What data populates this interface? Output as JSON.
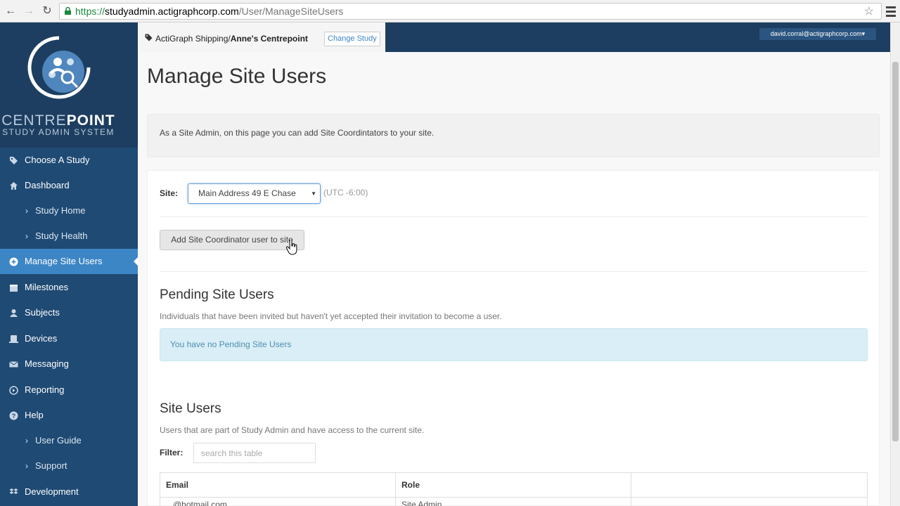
{
  "browser": {
    "url_scheme": "https://",
    "url_host": "studyadmin.actigraphcorp.com",
    "url_path": "/User/ManageSiteUsers"
  },
  "sidebar": {
    "brand_light": "CENTRE",
    "brand_bold": "POINT",
    "brand_sub": "STUDY ADMIN SYSTEM",
    "items": [
      {
        "label": "Choose A Study",
        "icon": "tags-icon"
      },
      {
        "label": "Dashboard",
        "icon": "home-icon"
      },
      {
        "label": "Study Home",
        "icon": "chevron-right-icon"
      },
      {
        "label": "Study Health",
        "icon": "chevron-right-icon"
      },
      {
        "label": "Manage Site Users",
        "icon": "plus-circle-icon"
      },
      {
        "label": "Milestones",
        "icon": "calendar-icon"
      },
      {
        "label": "Subjects",
        "icon": "user-icon"
      },
      {
        "label": "Devices",
        "icon": "device-icon"
      },
      {
        "label": "Messaging",
        "icon": "envelope-icon"
      },
      {
        "label": "Reporting",
        "icon": "reporting-icon"
      },
      {
        "label": "Help",
        "icon": "question-circle-icon"
      },
      {
        "label": "User Guide",
        "icon": "chevron-right-icon"
      },
      {
        "label": "Support",
        "icon": "chevron-right-icon"
      },
      {
        "label": "Development",
        "icon": "dropbox-icon"
      }
    ]
  },
  "topbar": {
    "study_prefix": "ActiGraph Shipping/",
    "study_name": "Anne's Centrepoint",
    "change_study": "Change Study",
    "user_email": "david.corral@actigraphcorp.com"
  },
  "main": {
    "title": "Manage Site Users",
    "info": "As a Site Admin, on this page you can add Site Coordintators to your site.",
    "site_label": "Site:",
    "site_value": "Main Address 49 E Chase",
    "timezone": "(UTC -6:00)",
    "add_button": "Add Site Coordinator user to site",
    "pending_title": "Pending Site Users",
    "pending_desc": "Individuals that have been invited but haven't yet accepted their invitation to become a user.",
    "pending_empty": "You have no Pending Site Users",
    "users_title": "Site Users",
    "users_desc": "Users that are part of Study Admin and have access to the current site.",
    "filter_label": "Filter:",
    "filter_placeholder": "search this table",
    "table_headers": [
      "Email",
      "Role",
      ""
    ],
    "table_rows": [
      [
        "...@hotmail.com",
        "Site Admin",
        ""
      ]
    ]
  },
  "colors": {
    "sidebar": "#1f4a74",
    "sidebar_active": "#3d86c6",
    "topbar": "#1d3e60",
    "alert_info": "#d9eef6"
  }
}
